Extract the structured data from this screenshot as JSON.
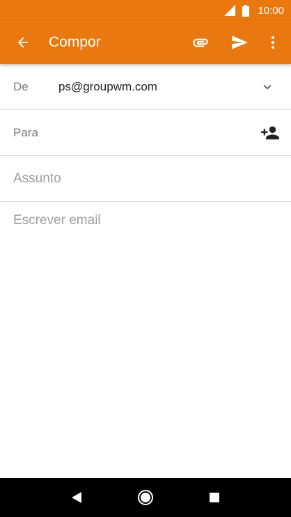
{
  "status_bar": {
    "time": "10:00",
    "icons": [
      "cellular-signal-icon",
      "battery-icon"
    ]
  },
  "app_bar": {
    "title": "Compor",
    "background_color": "#E9790F",
    "icons": [
      "back-arrow-icon",
      "attachment-icon",
      "send-icon",
      "more-vert-icon"
    ]
  },
  "compose": {
    "from_label": "De",
    "from_value": "ps@groupwm.com",
    "to_label": "Para",
    "to_value": "",
    "subject_placeholder": "Assunto",
    "subject_value": "",
    "body_placeholder": "Escrever email",
    "body_value": ""
  },
  "nav_bar": {
    "icons": [
      "back-triangle-icon",
      "home-circle-icon",
      "recents-square-icon"
    ]
  }
}
